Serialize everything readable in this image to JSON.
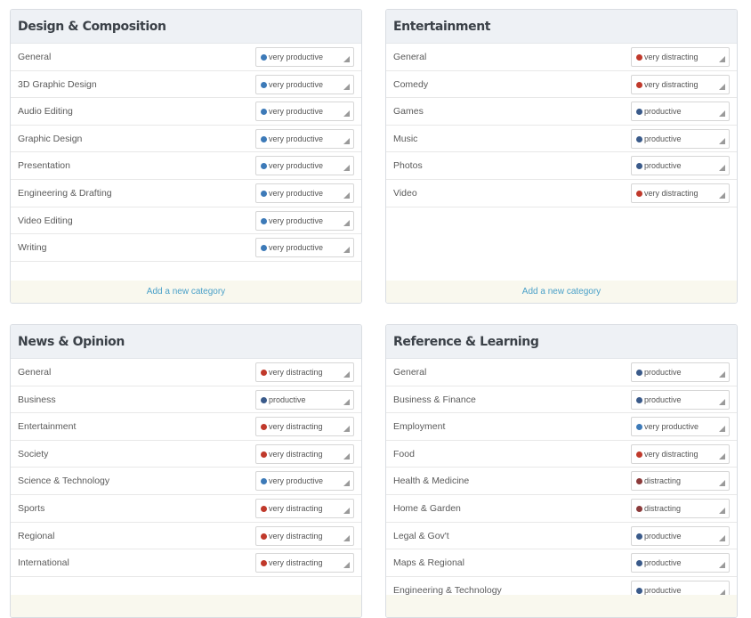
{
  "colors": {
    "very_productive": "#3d7ab8",
    "productive": "#3a5a8a",
    "very_distracting": "#c0392b",
    "distracting": "#8b3a3a"
  },
  "panels": [
    {
      "title": "Design & Composition",
      "add_link": "Add a new category",
      "rows": [
        {
          "label": "General",
          "status": "very productive",
          "level": "very_productive"
        },
        {
          "label": "3D Graphic Design",
          "status": "very productive",
          "level": "very_productive"
        },
        {
          "label": "Audio Editing",
          "status": "very productive",
          "level": "very_productive"
        },
        {
          "label": "Graphic Design",
          "status": "very productive",
          "level": "very_productive"
        },
        {
          "label": "Presentation",
          "status": "very productive",
          "level": "very_productive"
        },
        {
          "label": "Engineering & Drafting",
          "status": "very productive",
          "level": "very_productive"
        },
        {
          "label": "Video Editing",
          "status": "very productive",
          "level": "very_productive"
        },
        {
          "label": "Writing",
          "status": "very productive",
          "level": "very_productive"
        }
      ]
    },
    {
      "title": "Entertainment",
      "add_link": "Add a new category",
      "rows": [
        {
          "label": "General",
          "status": "very distracting",
          "level": "very_distracting"
        },
        {
          "label": "Comedy",
          "status": "very distracting",
          "level": "very_distracting"
        },
        {
          "label": "Games",
          "status": "productive",
          "level": "productive"
        },
        {
          "label": "Music",
          "status": "productive",
          "level": "productive"
        },
        {
          "label": "Photos",
          "status": "productive",
          "level": "productive"
        },
        {
          "label": "Video",
          "status": "very distracting",
          "level": "very_distracting"
        }
      ]
    },
    {
      "title": "News & Opinion",
      "add_link": "",
      "rows": [
        {
          "label": "General",
          "status": "very distracting",
          "level": "very_distracting"
        },
        {
          "label": "Business",
          "status": "productive",
          "level": "productive"
        },
        {
          "label": "Entertainment",
          "status": "very distracting",
          "level": "very_distracting"
        },
        {
          "label": "Society",
          "status": "very distracting",
          "level": "very_distracting"
        },
        {
          "label": "Science & Technology",
          "status": "very productive",
          "level": "very_productive"
        },
        {
          "label": "Sports",
          "status": "very distracting",
          "level": "very_distracting"
        },
        {
          "label": "Regional",
          "status": "very distracting",
          "level": "very_distracting"
        },
        {
          "label": "International",
          "status": "very distracting",
          "level": "very_distracting"
        }
      ]
    },
    {
      "title": "Reference & Learning",
      "add_link": "",
      "rows": [
        {
          "label": "General",
          "status": "productive",
          "level": "productive"
        },
        {
          "label": "Business & Finance",
          "status": "productive",
          "level": "productive"
        },
        {
          "label": "Employment",
          "status": "very productive",
          "level": "very_productive"
        },
        {
          "label": "Food",
          "status": "very distracting",
          "level": "very_distracting"
        },
        {
          "label": "Health & Medicine",
          "status": "distracting",
          "level": "distracting"
        },
        {
          "label": "Home & Garden",
          "status": "distracting",
          "level": "distracting"
        },
        {
          "label": "Legal & Gov't",
          "status": "productive",
          "level": "productive"
        },
        {
          "label": "Maps & Regional",
          "status": "productive",
          "level": "productive"
        },
        {
          "label": "Engineering & Technology",
          "status": "productive",
          "level": "productive"
        }
      ]
    }
  ]
}
